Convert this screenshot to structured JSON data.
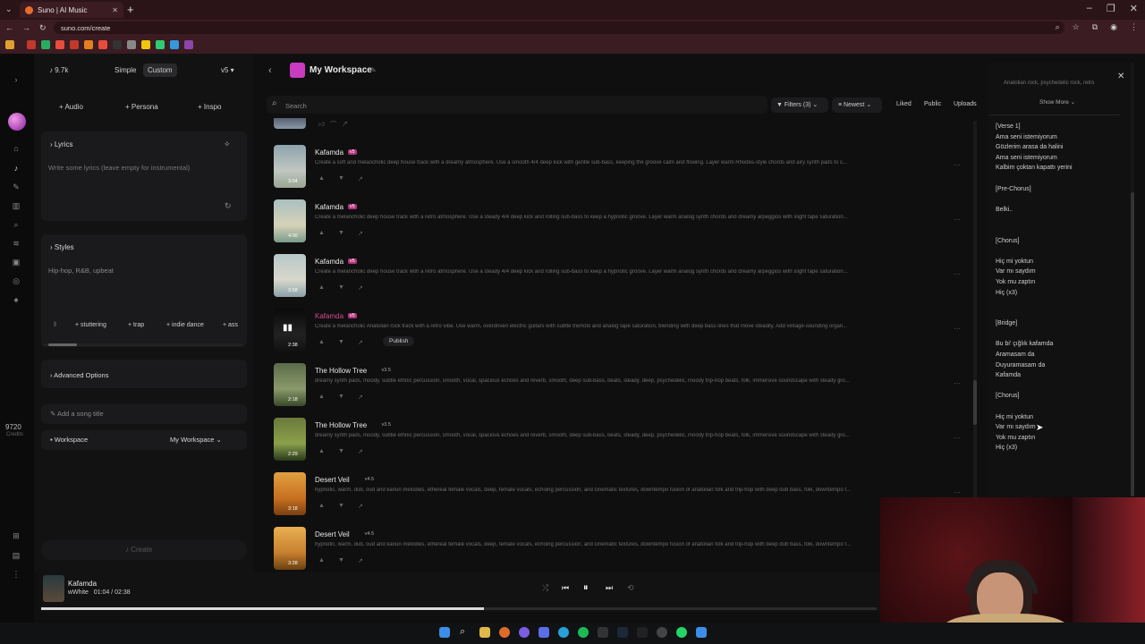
{
  "browser": {
    "tab_title": "Suno | AI Music",
    "url": "suno.com/create"
  },
  "left": {
    "credits_top": "9.7k",
    "mode_simple": "Simple",
    "mode_custom": "Custom",
    "model": "v5",
    "btn_audio": "Audio",
    "btn_persona": "Persona",
    "btn_inspo": "Inspo",
    "lyrics_label": "Lyrics",
    "lyrics_placeholder": "Write some lyrics (leave empty for instrumental)",
    "styles_label": "Styles",
    "styles_value": "Hip-hop, R&B, upbeat",
    "style_chips": [
      "stuttering",
      "trap",
      "indie dance",
      "ass"
    ],
    "advanced": "Advanced Options",
    "song_title_placeholder": "Add a song title",
    "workspace_label": "Workspace",
    "workspace_value": "My Workspace",
    "create": "Create",
    "credits_num": "9720",
    "credits_word": "Credits"
  },
  "main": {
    "workspace_title": "My Workspace",
    "search_placeholder": "Search",
    "filters": "Filters (3)",
    "sort": "Newest",
    "liked": "Liked",
    "public": "Public",
    "uploads": "Uploads",
    "publish": "Publish",
    "songs": [
      {
        "title": "Kafamda",
        "version": "v5",
        "duration": "3:04",
        "desc": "Create a soft and melancholic deep house track with a dreamy atmosphere. Use a smooth 4/4 deep kick with gentle sub-bass, keeping the groove calm and flowing. Layer warm Rhodes-style chords and airy synth pads to c..."
      },
      {
        "title": "Kafamda",
        "version": "v5",
        "duration": "4:00",
        "desc": "Create a melancholic deep house track with a retro atmosphere. Use a steady 4/4 deep kick and rolling sub-bass to keep a hypnotic groove. Layer warm analog synth chords and dreamy arpeggios with slight tape saturation..."
      },
      {
        "title": "Kafamda",
        "version": "v5",
        "duration": "3:58",
        "desc": "Create a melancholic deep house track with a retro atmosphere. Use a steady 4/4 deep kick and rolling sub-bass to keep a hypnotic groove. Layer warm analog synth chords and dreamy arpeggios with slight tape saturation..."
      },
      {
        "title": "Kafamda",
        "version": "v5",
        "duration": "2:38",
        "desc": "Create a melancholic Anatolian rock track with a retro vibe. Use warm, overdriven electric guitars with subtle tremolo and analog tape saturation, blending with deep bass lines that move steadily. Add vintage-sounding organ..."
      },
      {
        "title": "The Hollow Tree",
        "version": "v3.5",
        "duration": "2:18",
        "desc": "dreamy synth pads, moody, subtle ethnic percussion, smooth, vocal, spacious echoes and reverb, smooth, deep sub-bass, beats, steady, deep, psychedelic, moody trip-hop beats, folk, immersive soundscape with steady gro..."
      },
      {
        "title": "The Hollow Tree",
        "version": "v3.5",
        "duration": "2:29",
        "desc": "dreamy synth pads, moody, subtle ethnic percussion, smooth, vocal, spacious echoes and reverb, smooth, deep sub-bass, beats, steady, deep, psychedelic, moody trip-hop beats, folk, immersive soundscape with steady gro..."
      },
      {
        "title": "Desert Veil",
        "version": "v4.5",
        "duration": "3:18",
        "desc": "hypnotic, warm, dub, oud and kanun melodies, ethereal female vocals, deep, female vocals, echoing percussion, and cinematic textures, downtempo fusion of anatolian folk and trip-hop with deep dub bass, folk, downtempo f..."
      },
      {
        "title": "Desert Veil",
        "version": "v4.5",
        "duration": "3:28",
        "desc": "hypnotic, warm, dub, oud and kanun melodies, ethereal female vocals, deep, female vocals, echoing percussion, and cinematic textures, downtempo fusion of anatolian folk and trip-hop with deep dub bass, folk, downtempo f..."
      }
    ]
  },
  "right": {
    "style_text": "Anatolian rock, psychedelic rock, retro",
    "show_more": "Show More",
    "lyrics": [
      "[Verse 1]",
      "Ama seni istemiyorum",
      "Gözlerim arasa da halini",
      "Ama seni istemiyorum",
      "Kalbim çoktan kapattı yerini",
      "",
      "[Pre-Chorus]",
      "",
      "Belki..",
      "",
      "",
      "[Chorus]",
      "",
      "Hiç mi yoktun",
      "Var mı saydım",
      "Yok mu zaptın",
      "Hiç (x3)",
      "",
      "",
      "[Bridge]",
      "",
      "Bu bi' çığlık kafamda",
      "Aramasam da",
      "Duyuramasam da",
      "Kafamda",
      "",
      "[Chorus]",
      "",
      "Hiç mi yoktun",
      "Var mı saydım",
      "Yok mu zaptın",
      "Hiç (x3)"
    ]
  },
  "player": {
    "title": "Kafamda",
    "artist": "wWhite",
    "time": "01:04 / 02:38",
    "progress": 0.53
  },
  "colors": {
    "accent": "#c93bbf",
    "tag": "#b1337a",
    "bg": "#0f0f10"
  }
}
